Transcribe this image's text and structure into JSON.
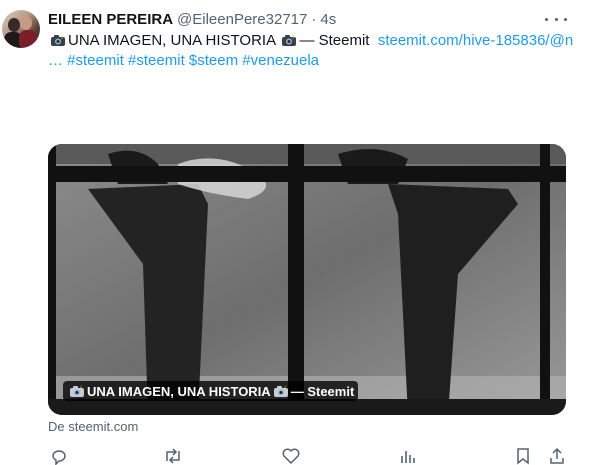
{
  "tweet": {
    "author_name": "EILEEN PEREIRA",
    "handle": "@EileenPere32717",
    "separator": "·",
    "time": "4s",
    "text_title": "UNA IMAGEN, UNA HISTORIA",
    "text_after": "— Steemit",
    "link_line1": "steemit.com/hive-",
    "link_line2": "185836/@n …",
    "hashtags": [
      "#steemit",
      "#steemit",
      "$steem",
      "#venezuela"
    ]
  },
  "card": {
    "overlay_title": "UNA IMAGEN, UNA HISTORIA",
    "overlay_suffix": "— Steemit",
    "source": "De steemit.com"
  },
  "icons": {
    "more": "more-dots-icon",
    "emoji": "camera-flash-emoji-icon",
    "reply": "reply-icon",
    "retweet": "retweet-icon",
    "like": "heart-icon",
    "views": "views-icon",
    "bookmark": "bookmark-icon",
    "share": "share-icon"
  },
  "colors": {
    "link": "#1d9bf0",
    "text": "#0f1419",
    "muted": "#536471"
  }
}
